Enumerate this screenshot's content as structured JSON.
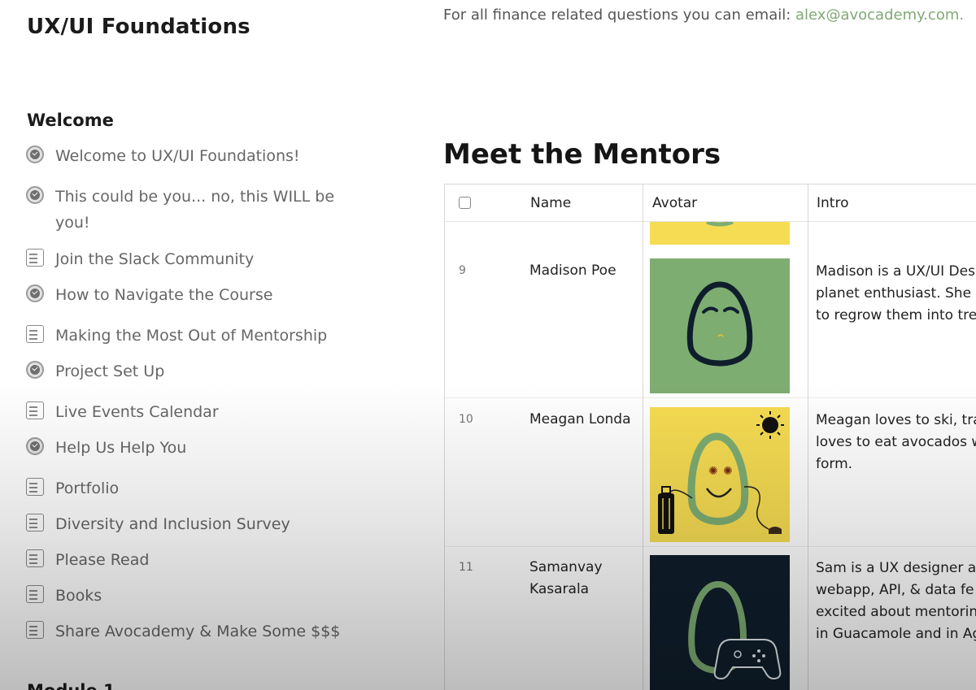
{
  "sidebar": {
    "course_title": "UX/UI Foundations",
    "section_title": "Welcome",
    "lessons": [
      {
        "label": "Welcome to UX/UI Foundations!",
        "icon": "check-circle-icon"
      },
      {
        "label": "This could be you... no, this WILL be",
        "label2": "you!",
        "icon": "check-circle-icon"
      },
      {
        "label": "Join the Slack Community",
        "icon": "document-icon"
      },
      {
        "label": "How to Navigate the Course",
        "icon": "check-circle-icon"
      },
      {
        "label": "Making the Most Out of Mentorship",
        "icon": "document-icon"
      },
      {
        "label": "Project Set Up",
        "icon": "check-circle-icon"
      },
      {
        "label": "Live Events Calendar",
        "icon": "document-icon"
      },
      {
        "label": "Help Us Help You",
        "icon": "check-circle-icon"
      },
      {
        "label": "Portfolio",
        "icon": "document-icon"
      },
      {
        "label": "Diversity and Inclusion Survey",
        "icon": "document-icon"
      },
      {
        "label": "Please Read",
        "icon": "document-icon"
      },
      {
        "label": "Books",
        "icon": "document-icon"
      },
      {
        "label": "Share Avocademy & Make Some $$$",
        "icon": "document-icon"
      }
    ],
    "next_section": "Module 1"
  },
  "main": {
    "finance_text": "For all finance related questions you can email: ",
    "finance_email": "alex@avocademy.com.",
    "mentors_title": "Meet the Mentors",
    "table": {
      "headers": {
        "name": "Name",
        "avatar": "Avotar",
        "intro": "Intro"
      },
      "rows": [
        {
          "num": "9",
          "name": "Madison Poe",
          "intro": [
            "Madison is a UX/UI Des",
            "planet enthusiast. She",
            "to regrow them into tre"
          ]
        },
        {
          "num": "10",
          "name": "Meagan Londa",
          "intro": [
            "Meagan loves to ski, tra",
            "loves to eat avocados w",
            "form."
          ]
        },
        {
          "num": "11",
          "name": "Samanvay Kasarala",
          "name1": "Samanvay",
          "name2": "Kasarala",
          "intro": [
            "Sam is a UX designer a",
            "webapp, API, & data fe",
            "excited about mentorin",
            "in Guacamole and in Ag"
          ]
        }
      ]
    }
  },
  "colors": {
    "accent_green": "#7faa74",
    "avatar_green": "#7ead72",
    "avatar_yellow": "#f6dc52",
    "avatar_navy": "#0f1e2c"
  }
}
